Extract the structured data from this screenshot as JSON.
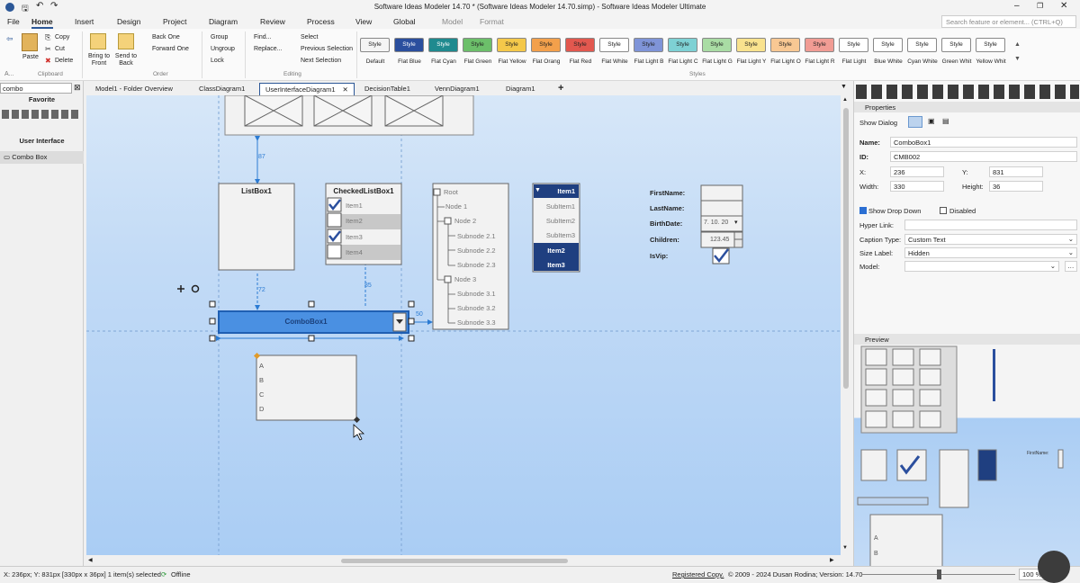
{
  "window": {
    "title": "Software Ideas Modeler 14.70 *  (Software Ideas Modeler 14.70.simp) - Software Ideas Modeler Ultimate"
  },
  "menu": [
    "File",
    "Home",
    "Insert",
    "Design",
    "Project",
    "Diagram",
    "Review",
    "Process",
    "View",
    "Global",
    "Model",
    "Format"
  ],
  "search": {
    "placeholder": "Search feature or element... (CTRL+Q)"
  },
  "ribbon": {
    "clipboard": {
      "paste": "Paste",
      "copy": "Copy",
      "cut": "Cut",
      "delete": "Delete",
      "group": "Clipboard",
      "a": "A..."
    },
    "order": {
      "bring_front": "Bring to Front",
      "send_back": "Send to Back",
      "back_one": "Back One",
      "forward_one": "Forward One",
      "group": "Order"
    },
    "grouping": {
      "group": "Group",
      "ungroup": "Ungroup",
      "lock": "Lock"
    },
    "editing": {
      "find": "Find...",
      "replace": "Replace...",
      "select": "Select",
      "prev": "Previous Selection",
      "next": "Next Selection",
      "group": "Editing"
    },
    "styles_group": "Styles",
    "styles": [
      {
        "name": "Default",
        "fill": "#f4f4f4",
        "text": "#222"
      },
      {
        "name": "Flat Blue",
        "fill": "#2b4f9e",
        "text": "#fff"
      },
      {
        "name": "Flat Cyan",
        "fill": "#1f8a8f",
        "text": "#fff"
      },
      {
        "name": "Flat Green",
        "fill": "#6cbf6a",
        "text": "#222"
      },
      {
        "name": "Flat Yellow",
        "fill": "#f4c84a",
        "text": "#222"
      },
      {
        "name": "Flat Orang",
        "fill": "#f3a04b",
        "text": "#222"
      },
      {
        "name": "Flat Red",
        "fill": "#e2584f",
        "text": "#222"
      },
      {
        "name": "Flat White",
        "fill": "#ffffff",
        "text": "#222"
      },
      {
        "name": "Flat Light B",
        "fill": "#7f94d8",
        "text": "#222"
      },
      {
        "name": "Flat Light C",
        "fill": "#7ed1d4",
        "text": "#222"
      },
      {
        "name": "Flat Light G",
        "fill": "#a9dca4",
        "text": "#222"
      },
      {
        "name": "Flat Light Y",
        "fill": "#f9e28e",
        "text": "#222"
      },
      {
        "name": "Flat Light O",
        "fill": "#f8c893",
        "text": "#222"
      },
      {
        "name": "Flat Light R",
        "fill": "#f19c94",
        "text": "#222"
      },
      {
        "name": "Flat Light",
        "fill": "#ffffff",
        "text": "#222"
      },
      {
        "name": "Blue White",
        "fill": "#ffffff",
        "text": "#222"
      },
      {
        "name": "Cyan White",
        "fill": "#ffffff",
        "text": "#222"
      },
      {
        "name": "Green Whit",
        "fill": "#ffffff",
        "text": "#222"
      },
      {
        "name": "Yellow Whit",
        "fill": "#ffffff",
        "text": "#222"
      }
    ],
    "style_swatch_text": "Style"
  },
  "left_panel": {
    "search_value": "combo",
    "favorite": "Favorite",
    "section": "User Interface",
    "item": "Combo Box"
  },
  "tabs": [
    "Model1 - Folder Overview",
    "ClassDiagram1",
    "UserInterfaceDiagram1",
    "DecisionTable1",
    "VennDiagram1",
    "Diagram1"
  ],
  "canvas": {
    "listbox_title": "ListBox1",
    "checked_title": "CheckedListBox1",
    "checked_items": [
      "Item1",
      "Item2",
      "Item3",
      "Item4"
    ],
    "tree": [
      "Root",
      "Node 1",
      "Node 2",
      "Subnode 2.1",
      "Subnode 2.2",
      "Subnode 2.3",
      "Node 3",
      "Subnode 3.1",
      "Subnode 3.2",
      "Subnode 3.3"
    ],
    "dropdown_items": [
      "Item1",
      "SubItem1",
      "SubItem2",
      "SubItem3",
      "Item2",
      "Item3"
    ],
    "form_labels": [
      "FirstName:",
      "LastName:",
      "BirthDate:",
      "Children:",
      "IsVip:"
    ],
    "birthdate_value": "7. 10. 20",
    "children_value": "123.45",
    "combobox_title": "ComboBox1",
    "list_items": [
      "A",
      "B",
      "C",
      "D"
    ],
    "dim_87": "87",
    "dim_72": "72",
    "dim_85": "85",
    "dim_50": "50"
  },
  "properties": {
    "header": "Properties",
    "show_dialog": "Show Dialog",
    "name_label": "Name:",
    "name_value": "ComboBox1",
    "id_label": "ID:",
    "id_value": "CMB002",
    "x_label": "X:",
    "x_value": "236",
    "y_label": "Y:",
    "y_value": "831",
    "width_label": "Width:",
    "width_value": "330",
    "height_label": "Height:",
    "height_value": "36",
    "show_dropdown": "Show Drop Down",
    "disabled": "Disabled",
    "hyperlink_label": "Hyper Link:",
    "caption_type_label": "Caption Type:",
    "caption_type_value": "Custom Text",
    "size_label_label": "Size Label:",
    "size_label_value": "Hidden",
    "model_label": "Model:"
  },
  "preview": {
    "header": "Preview",
    "firstname": "FirstName:"
  },
  "status": {
    "coords": "X: 236px; Y: 831px  [330px x 36px] 1 item(s) selected",
    "offline": "Offline",
    "registered": "Registered Copy.",
    "copyright": "© 2009 - 2024 Dusan Rodina; Version: 14.70",
    "zoom": "100 %"
  }
}
